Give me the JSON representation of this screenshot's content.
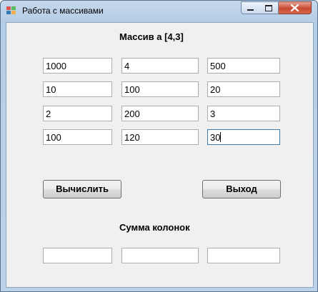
{
  "window": {
    "title": "Работа с массивами"
  },
  "caption_buttons": {
    "minimize": "minimize-icon",
    "maximize": "maximize-icon",
    "close": "close-icon"
  },
  "matrix": {
    "heading": "Массив a [4,3]",
    "rows": [
      [
        "1000",
        "4",
        "500"
      ],
      [
        "10",
        "100",
        "20"
      ],
      [
        "2",
        "200",
        "3"
      ],
      [
        "100",
        "120",
        "30"
      ]
    ]
  },
  "buttons": {
    "calculate": "Вычислить",
    "exit": "Выход"
  },
  "sums": {
    "heading": "Сумма колонок",
    "values": [
      "",
      "",
      ""
    ]
  },
  "colors": {
    "title_bar": "#b4cde6",
    "client_bg": "#f0f0f0",
    "close_button": "#c74a32"
  }
}
